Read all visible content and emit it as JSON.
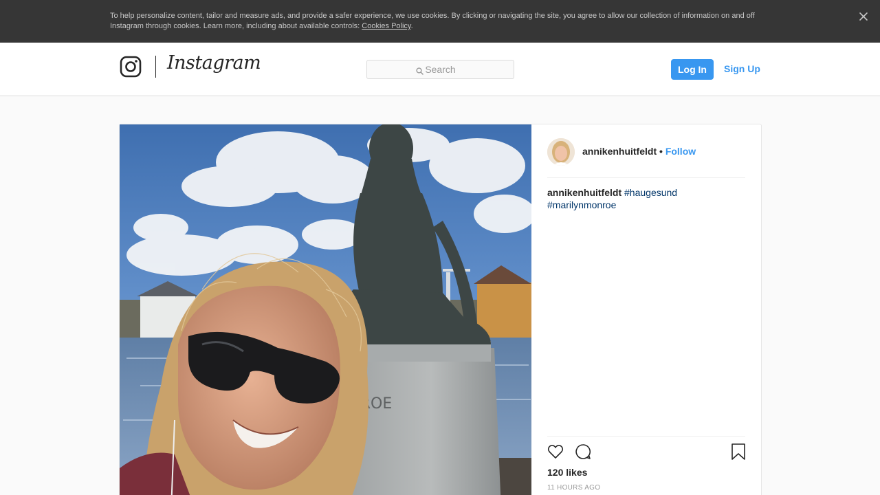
{
  "cookie_banner": {
    "text": "To help personalize content, tailor and measure ads, and provide a safer experience, we use cookies. By clicking or navigating the site, you agree to allow our collection of information on and off Instagram through cookies. Learn more, including about available controls: ",
    "link_label": "Cookies Policy",
    "trailing": ".",
    "close_icon": "close-icon"
  },
  "header": {
    "logo_icon": "instagram-glyph-icon",
    "wordmark": "Instagram",
    "search": {
      "placeholder": "Search",
      "value": "",
      "icon": "search-icon"
    },
    "login_label": "Log In",
    "signup_label": "Sign Up"
  },
  "post": {
    "photo_text": "ONROE",
    "author": "annikenhuitfeldt",
    "separator": "•",
    "follow_label": "Follow",
    "caption": {
      "user": "annikenhuitfeldt",
      "hashtags": [
        "#haugesund",
        "#marilynmonroe"
      ]
    },
    "likes": "120 likes",
    "timestamp": "11 HOURS AGO",
    "icons": {
      "like": "heart-icon",
      "comment": "comment-icon",
      "bookmark": "bookmark-icon"
    }
  },
  "colors": {
    "accent": "#3897f0",
    "hashtag": "#003569",
    "banner_bg": "#363636",
    "page_bg": "#fafafa"
  }
}
